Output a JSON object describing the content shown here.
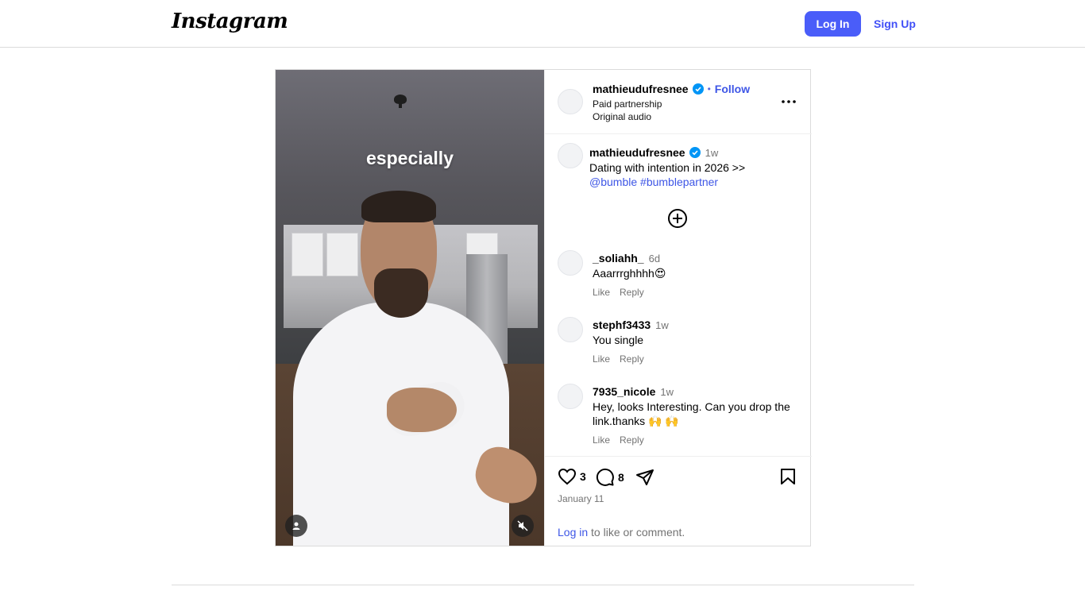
{
  "nav": {
    "logo": "Instagram",
    "login_label": "Log In",
    "signup_label": "Sign Up"
  },
  "media": {
    "caption_overlay": "especially",
    "icons": [
      "user-tag-icon",
      "mute-icon"
    ]
  },
  "header": {
    "username": "mathieudufresnee",
    "separator": "•",
    "follow_label": "Follow",
    "subtitle1": "Paid partnership",
    "subtitle2": "Original audio"
  },
  "caption": {
    "username": "mathieudufresnee",
    "time": "1w",
    "text": "Dating with intention in 2026 >>",
    "mention": "@bumble",
    "hashtag": "#bumblepartner"
  },
  "comments": [
    {
      "username": "_soliahh_",
      "time": "6d",
      "text": "Aaarrrghhhh😍",
      "like": "Like",
      "reply": "Reply"
    },
    {
      "username": "stephf3433",
      "time": "1w",
      "text": "You single",
      "like": "Like",
      "reply": "Reply"
    },
    {
      "username": "7935_nicole",
      "time": "1w",
      "text": "Hey, looks Interesting. Can you drop the link.thanks 🙌 🙌",
      "like": "Like",
      "reply": "Reply"
    }
  ],
  "actions": {
    "likes": "3",
    "comments": "8",
    "date": "January 11",
    "login_link": "Log in",
    "login_rest": " to like or comment."
  },
  "colors": {
    "accent": "#4a5df9",
    "link": "#3e56e6",
    "verified": "#0095f6",
    "muted": "#737373",
    "border": "#dbdbdb"
  }
}
